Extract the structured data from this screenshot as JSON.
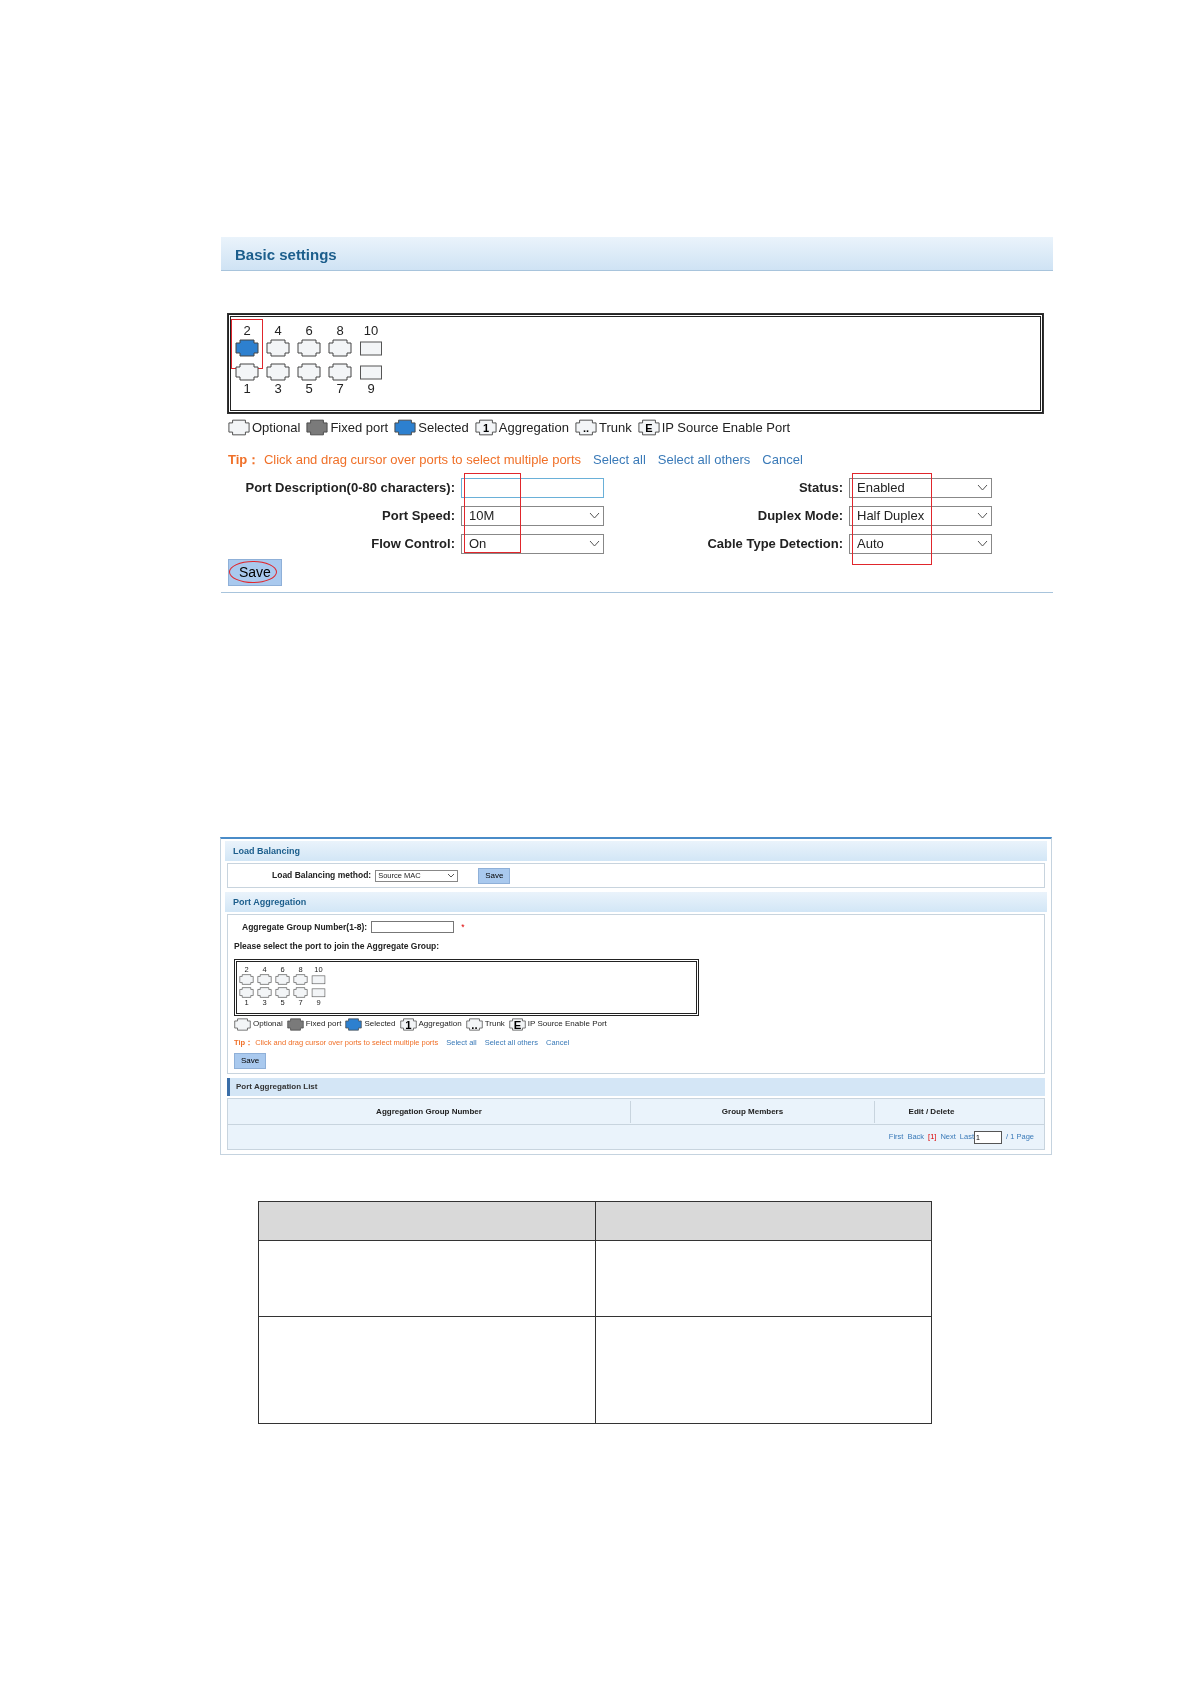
{
  "basic_settings": {
    "title": "Basic settings",
    "ports_top": [
      {
        "label": "2",
        "kind": "copper",
        "selected": true,
        "marked": true
      },
      {
        "label": "4",
        "kind": "copper",
        "selected": false,
        "marked": false
      },
      {
        "label": "6",
        "kind": "copper",
        "selected": false,
        "marked": false
      },
      {
        "label": "8",
        "kind": "copper",
        "selected": false,
        "marked": false
      },
      {
        "label": "10",
        "kind": "fiber",
        "selected": false,
        "marked": false
      }
    ],
    "ports_bottom": [
      {
        "label": "1",
        "kind": "copper",
        "selected": false,
        "marked": false
      },
      {
        "label": "3",
        "kind": "copper",
        "selected": false,
        "marked": false
      },
      {
        "label": "5",
        "kind": "copper",
        "selected": false,
        "marked": false
      },
      {
        "label": "7",
        "kind": "copper",
        "selected": false,
        "marked": false
      },
      {
        "label": "9",
        "kind": "fiber",
        "selected": false,
        "marked": false
      }
    ],
    "legend": [
      {
        "kind": "optional",
        "label": "Optional"
      },
      {
        "kind": "fixed",
        "label": "Fixed port"
      },
      {
        "kind": "selected",
        "label": "Selected"
      },
      {
        "kind": "aggregation",
        "glyph": "1",
        "label": "Aggregation"
      },
      {
        "kind": "trunk",
        "glyph": "..",
        "label": "Trunk"
      },
      {
        "kind": "ip_source",
        "glyph": "E",
        "label": "IP Source Enable Port"
      }
    ],
    "tip": {
      "label": "Tip：",
      "text": "Click and drag cursor over ports to select multiple ports"
    },
    "links": [
      "Select all",
      "Select all others",
      "Cancel"
    ],
    "left_fields": [
      {
        "label": "Port Description(0-80 characters):",
        "kind": "text"
      },
      {
        "label": "Port Speed:",
        "kind": "select",
        "value": "10M"
      },
      {
        "label": "Flow Control:",
        "kind": "select",
        "value": "On"
      }
    ],
    "right_fields": [
      {
        "label": "Status:",
        "kind": "select",
        "value": "Enabled"
      },
      {
        "label": "Duplex Mode:",
        "kind": "select",
        "value": "Half Duplex"
      },
      {
        "label": "Cable Type Detection:",
        "kind": "select",
        "value": "Auto"
      }
    ],
    "left_values_marked": true,
    "right_values_marked": true,
    "save_button": {
      "label": "Save",
      "marked": true
    }
  },
  "aggregation": {
    "load_balancing": {
      "title": "Load Balancing",
      "label": "Load Balancing method:",
      "value": "Source MAC",
      "save": "Save"
    },
    "port_aggregation": {
      "title": "Port Aggregation",
      "group_label": "Aggregate Group Number(1-8):",
      "required": "*",
      "prompt": "Please select the port to join the Aggregate Group:",
      "ports_top": [
        {
          "label": "2",
          "kind": "copper",
          "selected": false
        },
        {
          "label": "4",
          "kind": "copper",
          "selected": false
        },
        {
          "label": "6",
          "kind": "copper",
          "selected": false
        },
        {
          "label": "8",
          "kind": "copper",
          "selected": false
        },
        {
          "label": "10",
          "kind": "fiber",
          "selected": false
        }
      ],
      "ports_bottom": [
        {
          "label": "1",
          "kind": "copper",
          "selected": false
        },
        {
          "label": "3",
          "kind": "copper",
          "selected": false
        },
        {
          "label": "5",
          "kind": "copper",
          "selected": false
        },
        {
          "label": "7",
          "kind": "copper",
          "selected": false
        },
        {
          "label": "9",
          "kind": "fiber",
          "selected": false
        }
      ],
      "legend": [
        {
          "kind": "optional",
          "label": "Optional"
        },
        {
          "kind": "fixed",
          "label": "Fixed port"
        },
        {
          "kind": "selected",
          "label": "Selected"
        },
        {
          "kind": "aggregation",
          "glyph": "1",
          "label": "Aggregation"
        },
        {
          "kind": "trunk",
          "glyph": "..",
          "label": "Trunk"
        },
        {
          "kind": "ip_source",
          "glyph": "E",
          "label": "IP Source Enable Port"
        }
      ],
      "tip": {
        "label": "Tip：",
        "text": "Click and drag cursor over ports to select multiple ports"
      },
      "links": [
        "Select all",
        "Select all others",
        "Cancel"
      ],
      "save": "Save"
    },
    "list": {
      "title": "Port Aggregation List",
      "columns": [
        "Aggregation Group Number",
        "Group Members",
        "Edit / Delete"
      ],
      "pager": {
        "first": "First",
        "back": "Back",
        "current": "[1]",
        "next": "Next",
        "last": "Last",
        "page_value": "1",
        "total": "/ 1 Page"
      }
    }
  },
  "blank_table": {
    "header": [
      {
        "kind": "blank"
      },
      {
        "kind": "blank"
      }
    ],
    "rows": [
      [
        {
          "kind": "blank"
        },
        {
          "kind": "blank"
        }
      ],
      [
        {
          "kind": "blank"
        },
        {
          "kind": "blank"
        }
      ]
    ]
  }
}
